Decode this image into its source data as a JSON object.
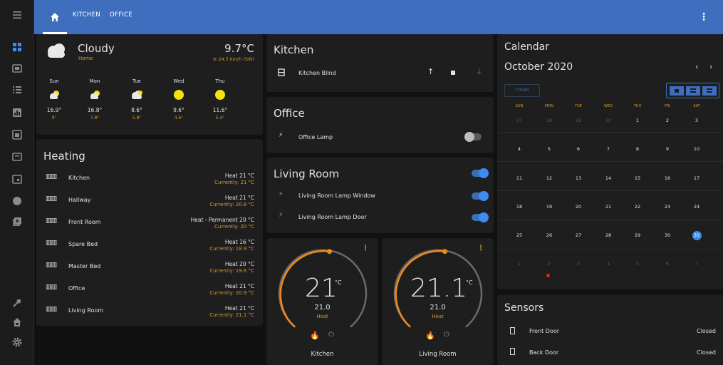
{
  "tabs": [
    "KITCHEN",
    "OFFICE"
  ],
  "weather": {
    "condition": "Cloudy",
    "location": "Home",
    "temp": "9.7°C",
    "wind": "24.5 km/h (SW)",
    "forecast": [
      {
        "day": "Sun",
        "icon": "partly-cloudy-icon",
        "high": "16.9°",
        "low": "9°"
      },
      {
        "day": "Mon",
        "icon": "partly-cloudy-icon",
        "high": "16.8°",
        "low": "7.8°"
      },
      {
        "day": "Tue",
        "icon": "cloudy-icon",
        "high": "8.6°",
        "low": "5.8°"
      },
      {
        "day": "Wed",
        "icon": "sunny-icon",
        "high": "9.6°",
        "low": "4.6°"
      },
      {
        "day": "Thu",
        "icon": "sunny-icon",
        "high": "11.6°",
        "low": "5.4°"
      }
    ]
  },
  "heating": {
    "title": "Heating",
    "rows": [
      {
        "name": "Kitchen",
        "status": "Heat 21 °C",
        "current": "Currently: 21 °C"
      },
      {
        "name": "Hallway",
        "status": "Heat 21 °C",
        "current": "Currently: 20.8 °C"
      },
      {
        "name": "Front Room",
        "status": "Heat - Permanent 20 °C",
        "current": "Currently: 20 °C"
      },
      {
        "name": "Spare Bed",
        "status": "Heat 16 °C",
        "current": "Currently: 18.9 °C"
      },
      {
        "name": "Master Bed",
        "status": "Heat 20 °C",
        "current": "Currently: 19.6 °C"
      },
      {
        "name": "Office",
        "status": "Heat 21 °C",
        "current": "Currently: 20.9 °C"
      },
      {
        "name": "Living Room",
        "status": "Heat 21 °C",
        "current": "Currently: 21.1 °C"
      }
    ]
  },
  "kitchen": {
    "title": "Kitchen",
    "blind": "Kitchen Blind"
  },
  "office": {
    "title": "Office",
    "lamp": "Office Lamp",
    "lamp_on": false
  },
  "living": {
    "title": "Living Room",
    "on": true,
    "items": [
      {
        "name": "Living Room Lamp Window",
        "on": true
      },
      {
        "name": "Living Room Lamp Door",
        "on": true
      }
    ]
  },
  "thermostats": [
    {
      "value": "21",
      "unit": "°C",
      "target": "21.0",
      "mode": "Heat",
      "name": "Kitchen"
    },
    {
      "value": "21.1",
      "unit": "°C",
      "target": "21.0",
      "mode": "Heat",
      "name": "Living Room"
    }
  ],
  "calendar": {
    "title": "Calendar",
    "month": "October 2020",
    "today": "TODAY",
    "weekdays": [
      "SUN",
      "MON",
      "TUE",
      "WED",
      "THU",
      "FRI",
      "SAT"
    ],
    "weeks": [
      [
        "27",
        "28",
        "29",
        "30",
        "1",
        "2",
        "3"
      ],
      [
        "4",
        "5",
        "6",
        "7",
        "8",
        "9",
        "10"
      ],
      [
        "11",
        "12",
        "13",
        "14",
        "15",
        "16",
        "17"
      ],
      [
        "18",
        "19",
        "20",
        "21",
        "22",
        "23",
        "24"
      ],
      [
        "25",
        "26",
        "27",
        "28",
        "29",
        "30",
        "31"
      ],
      [
        "1",
        "2",
        "3",
        "4",
        "5",
        "6",
        "7"
      ]
    ],
    "today_date": "31"
  },
  "sensors": {
    "title": "Sensors",
    "rows": [
      {
        "name": "Front Door",
        "state": "Closed"
      },
      {
        "name": "Back Door",
        "state": "Closed"
      }
    ]
  },
  "colors": {
    "accent": "#3f6ebf",
    "heat": "#ef8a17",
    "orange_text": "#d69a2c",
    "toggle_on": "#3f8cf0"
  }
}
